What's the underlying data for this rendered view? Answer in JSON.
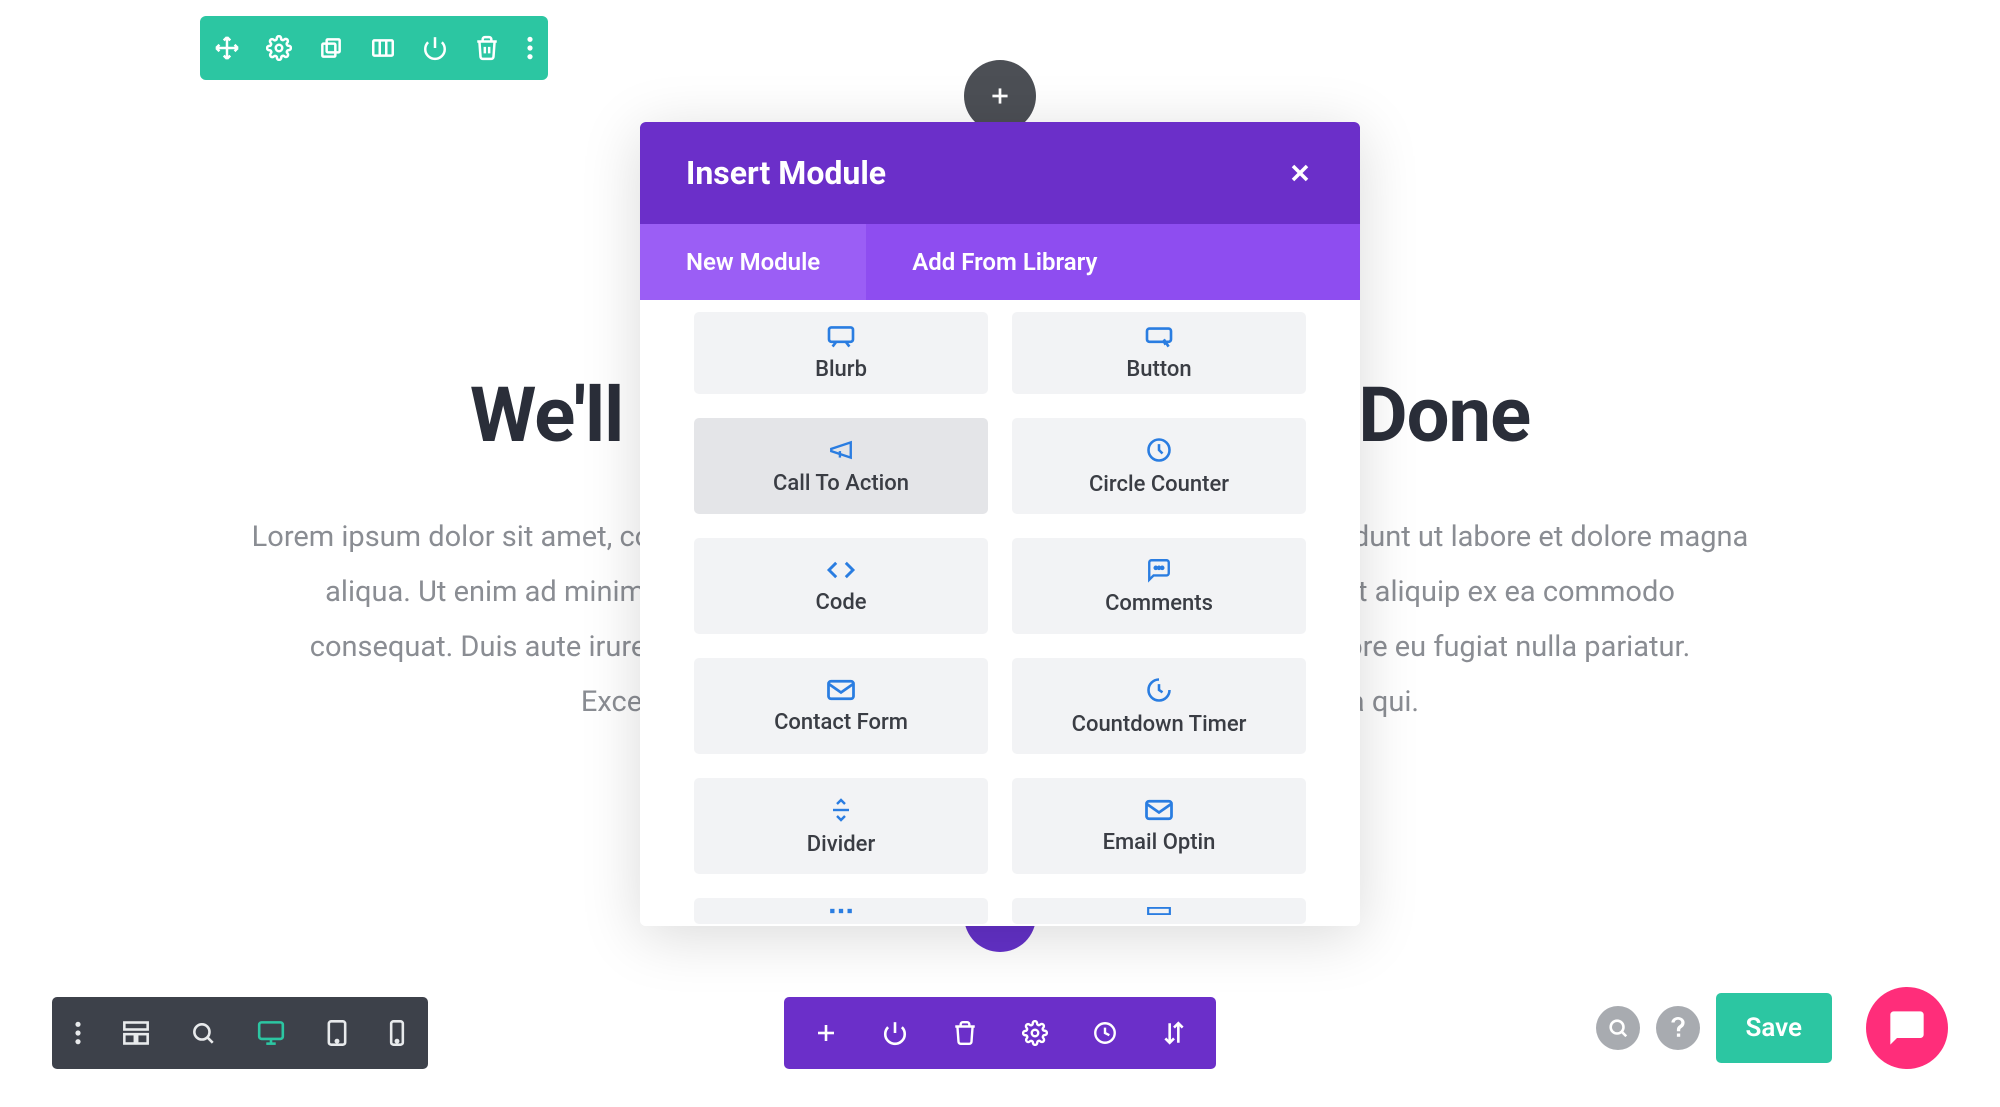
{
  "section_toolbar": {
    "icons": [
      "move",
      "gear",
      "duplicate",
      "columns",
      "power",
      "trash",
      "more"
    ]
  },
  "background": {
    "title": "We'll Help You Get the Job Done",
    "body": "Lorem ipsum dolor sit amet, consectetur adipiscing elit, sed do eiusmod tempor incididunt ut labore et dolore magna aliqua. Ut enim ad minim veniam, quis nostrud exercitation ullamco laboris nisi ut aliquip ex ea commodo consequat. Duis aute irure dolor in reprehenderit in voluptate velit esse cillum dolore eu fugiat nulla pariatur. Excepteur sint occaecat cupidatat non proident, sunt in culpa qui."
  },
  "modal": {
    "title": "Insert Module",
    "tabs": {
      "new_module": "New Module",
      "add_from_library": "Add From Library"
    },
    "modules": [
      {
        "label": "Blurb",
        "icon": "blurb"
      },
      {
        "label": "Button",
        "icon": "button"
      },
      {
        "label": "Call To Action",
        "icon": "cta",
        "hover": true
      },
      {
        "label": "Circle Counter",
        "icon": "circle-counter"
      },
      {
        "label": "Code",
        "icon": "code"
      },
      {
        "label": "Comments",
        "icon": "comments"
      },
      {
        "label": "Contact Form",
        "icon": "contact-form"
      },
      {
        "label": "Countdown Timer",
        "icon": "countdown"
      },
      {
        "label": "Divider",
        "icon": "divider"
      },
      {
        "label": "Email Optin",
        "icon": "email-optin"
      }
    ]
  },
  "bottom_left": {
    "icons": [
      "more-vertical",
      "wireframe",
      "search",
      "desktop",
      "tablet",
      "phone"
    ]
  },
  "bottom_center": {
    "icons": [
      "plus",
      "power",
      "trash",
      "gear",
      "clock",
      "sort"
    ]
  },
  "bottom_right": {
    "search_icon": "search",
    "help_icon": "help",
    "save_label": "Save"
  }
}
